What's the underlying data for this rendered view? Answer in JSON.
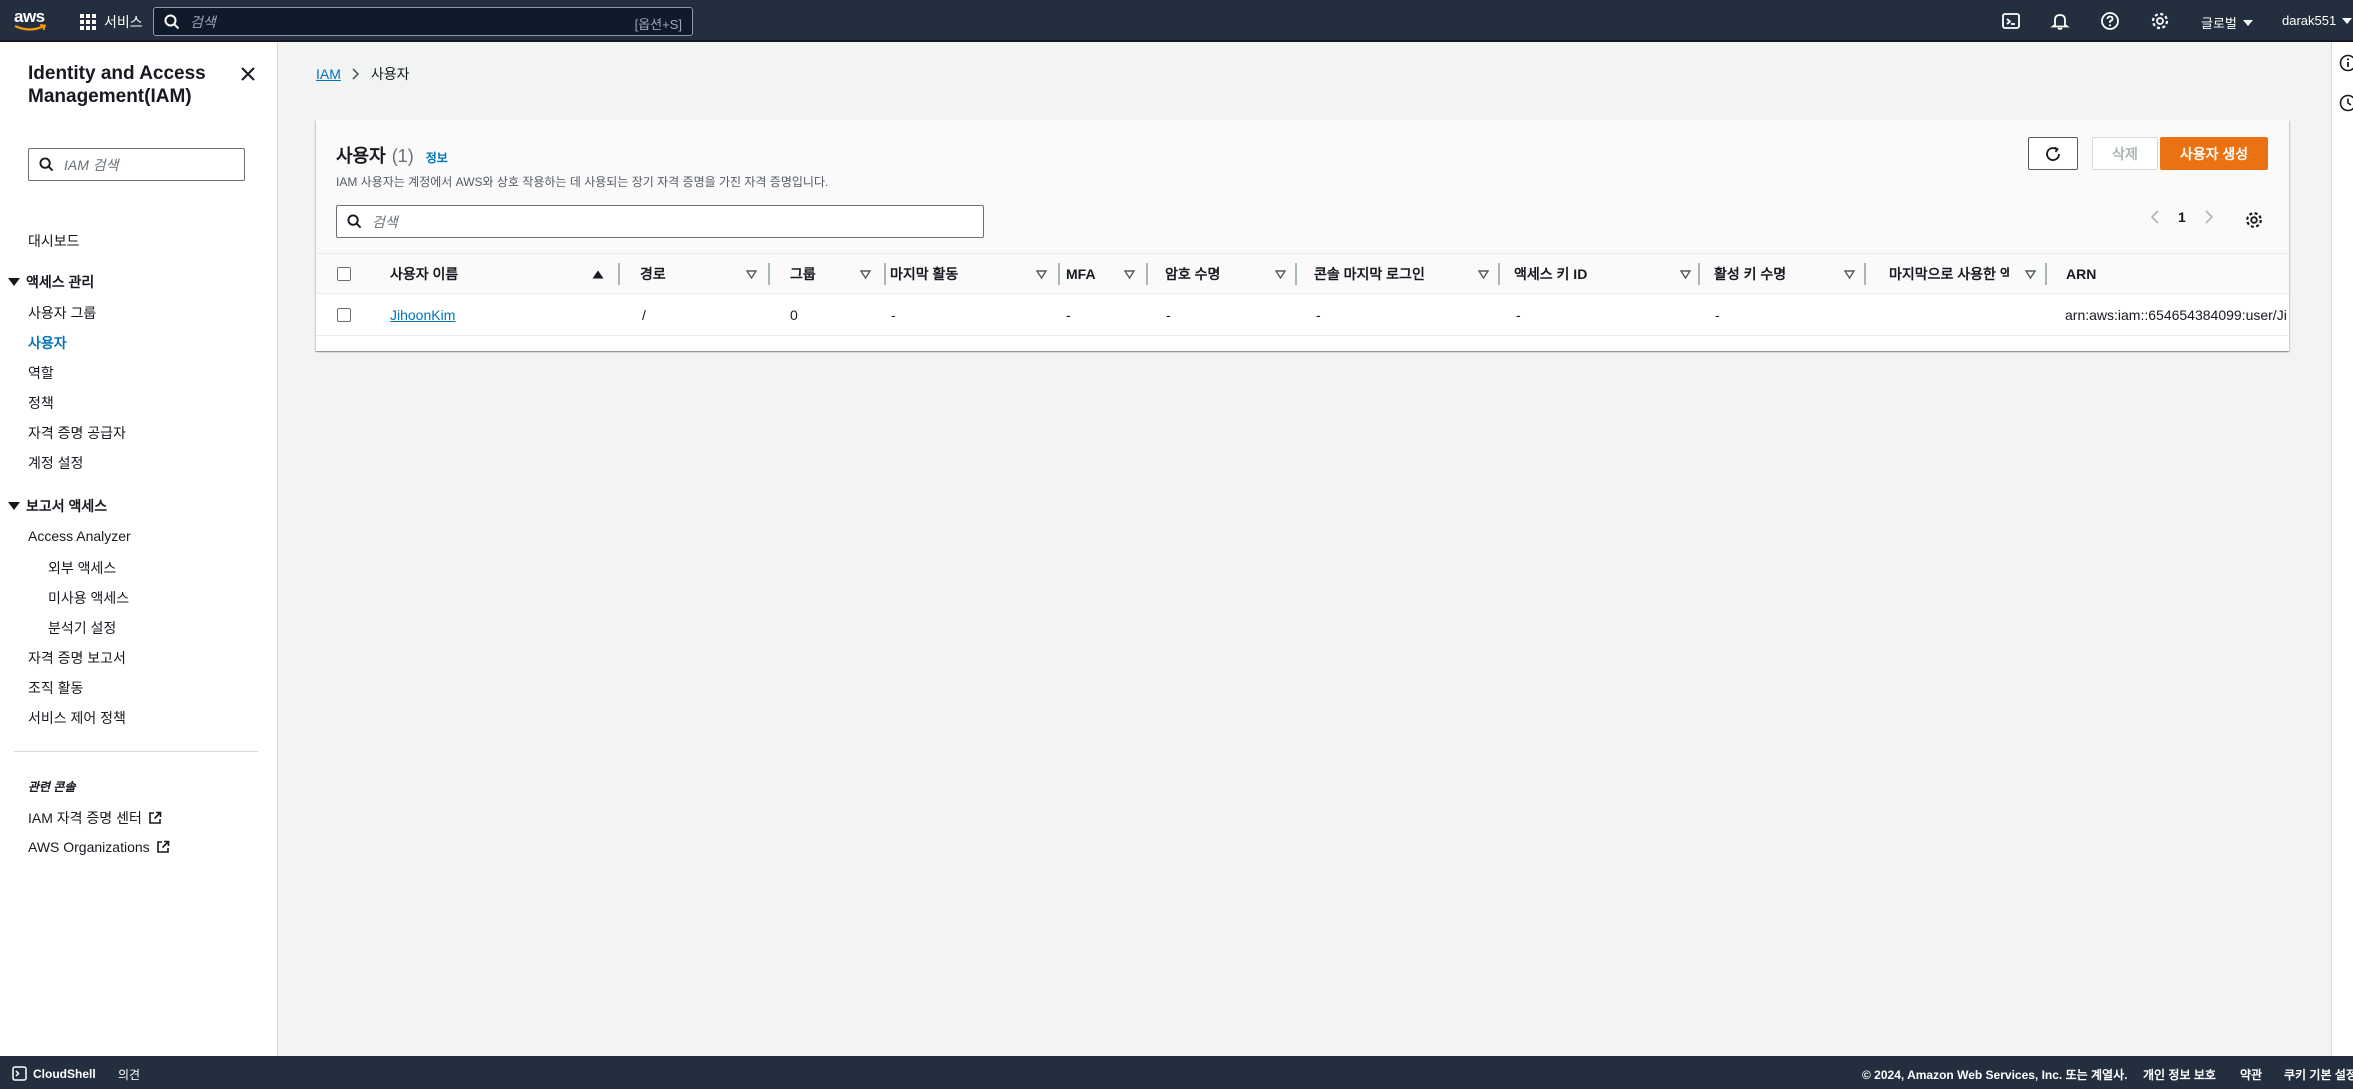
{
  "topnav": {
    "logo_text": "aws",
    "services_label": "서비스",
    "search_placeholder": "검색",
    "search_shortcut": "[옵션+S]",
    "region_label": "글로벌",
    "account_label": "darak551",
    "icons": [
      "cloudshell-icon",
      "bell-icon",
      "help-icon",
      "gear-icon"
    ]
  },
  "sidebar": {
    "title": "Identity and Access Management(IAM)",
    "search_placeholder": "IAM 검색",
    "dashboard": "대시보드",
    "access_mgmt": {
      "label": "액세스 관리",
      "items": [
        "사용자 그룹",
        "사용자",
        "역할",
        "정책",
        "자격 증명 공급자",
        "계정 설정"
      ],
      "active": "사용자"
    },
    "access_reports": {
      "label": "보고서 액세스",
      "analyzer": "Access Analyzer",
      "analyzer_items": [
        "외부 액세스",
        "미사용 액세스",
        "분석기 설정"
      ],
      "items": [
        "자격 증명 보고서",
        "조직 활동",
        "서비스 제어 정책"
      ]
    },
    "related_title": "관련 콘솔",
    "related": [
      "IAM 자격 증명 센터",
      "AWS Organizations"
    ]
  },
  "breadcrumb": {
    "root": "IAM",
    "current": "사용자"
  },
  "users_panel": {
    "title": "사용자",
    "count": "(1)",
    "info": "정보",
    "description": "IAM 사용자는 계정에서 AWS와 상호 작용하는 데 사용되는 장기 자격 증명을 가진 자격 증명입니다.",
    "delete_label": "삭제",
    "create_label": "사용자 생성",
    "search_placeholder": "검색",
    "page": "1",
    "columns": [
      "사용자 이름",
      "경로",
      "그룹",
      "마지막 활동",
      "MFA",
      "암호 수명",
      "콘솔 마지막 로그인",
      "액세스 키 ID",
      "활성 키 수명",
      "마지막으로 사용한 액세",
      "ARN"
    ],
    "rows": [
      {
        "username": "JihoonKim",
        "path": "/",
        "groups": "0",
        "last_activity": "-",
        "mfa": "-",
        "password_age": "-",
        "console_last_login": "-",
        "access_key_id": "-",
        "active_key_age": "-",
        "last_used": "",
        "arn": "arn:aws:iam::654654384099:user/Ji"
      }
    ]
  },
  "footer": {
    "cloudshell": "CloudShell",
    "feedback": "의견",
    "copyright": "© 2024, Amazon Web Services, Inc. 또는 계열사.",
    "privacy": "개인 정보 보호",
    "terms": "약관",
    "cookies": "쿠키 기본 설정"
  },
  "colors": {
    "nav_bg": "#232f3e",
    "link": "#0073bb",
    "primary_button": "#ec7211"
  }
}
